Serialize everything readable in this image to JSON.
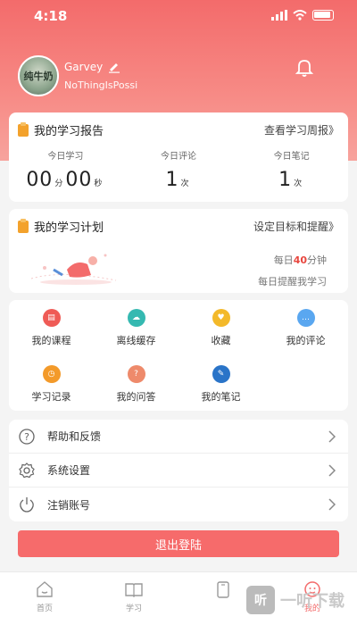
{
  "status_bar": {
    "time": "4:18"
  },
  "profile": {
    "username": "Garvey",
    "subtitle": "NoThingIsPossi",
    "avatar_text": "纯牛奶"
  },
  "report": {
    "title": "我的学习报告",
    "link": "查看学习周报》",
    "stats": [
      {
        "label": "今日学习",
        "value_a": "00",
        "unit_a": "分",
        "value_b": "00",
        "unit_b": "秒"
      },
      {
        "label": "今日评论",
        "value": "1",
        "unit": "次"
      },
      {
        "label": "今日笔记",
        "value": "1",
        "unit": "次"
      }
    ]
  },
  "plan": {
    "title": "我的学习计划",
    "link": "设定目标和提醒》",
    "line1_prefix": "每日",
    "line1_num": "40",
    "line1_suffix": "分钟",
    "line2": "每日提醒我学习"
  },
  "features": [
    {
      "label": "我的课程",
      "icon": "course-icon",
      "color": "#ef5b56"
    },
    {
      "label": "离线缓存",
      "icon": "download-icon",
      "color": "#35b9b1"
    },
    {
      "label": "收藏",
      "icon": "favorite-icon",
      "color": "#f3b92a"
    },
    {
      "label": "我的评论",
      "icon": "comment-icon",
      "color": "#5aa7f0"
    },
    {
      "label": "学习记录",
      "icon": "clock-icon",
      "color": "#f39a2a"
    },
    {
      "label": "我的问答",
      "icon": "qa-icon",
      "color": "#ee8a6b"
    },
    {
      "label": "我的笔记",
      "icon": "pen-icon",
      "color": "#2a74c8"
    }
  ],
  "settings": [
    {
      "label": "帮助和反馈",
      "icon": "help-icon"
    },
    {
      "label": "系统设置",
      "icon": "gear-icon"
    },
    {
      "label": "注销账号",
      "icon": "power-icon"
    }
  ],
  "logout_label": "退出登陆",
  "tabs": [
    {
      "label": "首页",
      "icon": "home-icon"
    },
    {
      "label": "学习",
      "icon": "book-icon"
    },
    {
      "label": "",
      "icon": "tablet-icon"
    },
    {
      "label": "我的",
      "icon": "profile-icon",
      "active": true
    }
  ],
  "watermark": {
    "box": "听",
    "text": "一听下载"
  },
  "colors": {
    "accent": "#f36b6b",
    "highlight": "#e8473f"
  }
}
